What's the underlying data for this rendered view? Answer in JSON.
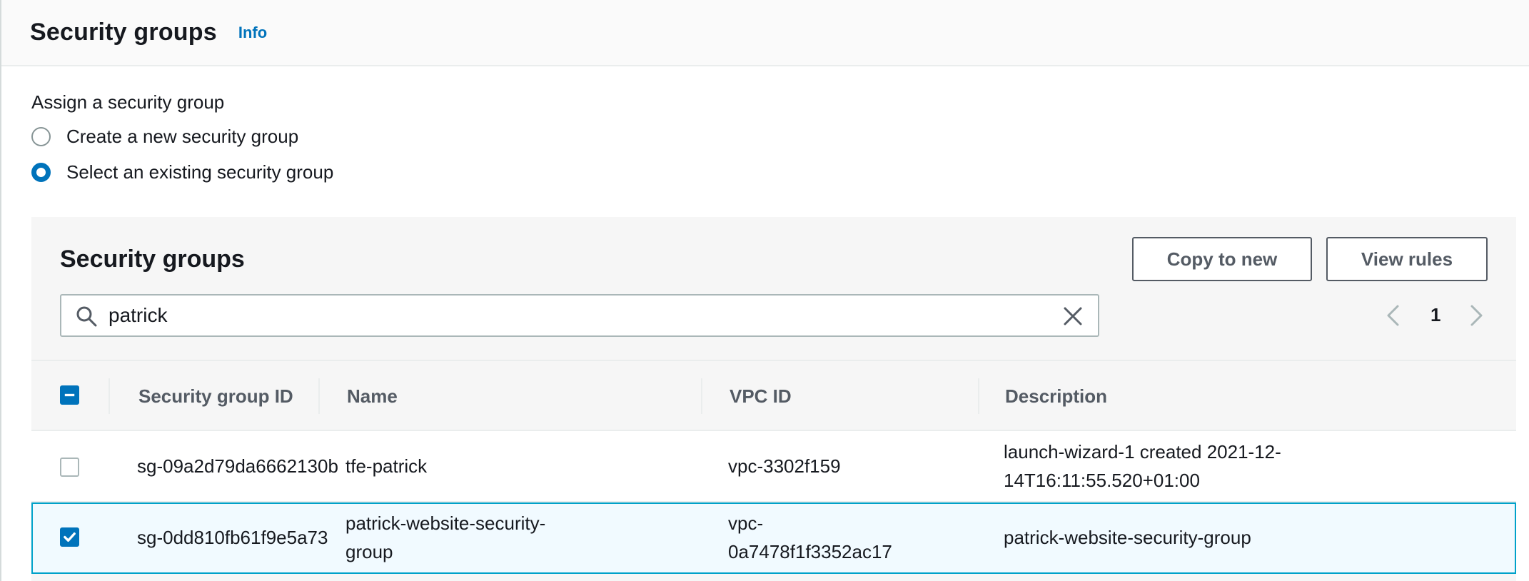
{
  "header": {
    "title": "Security groups",
    "info_label": "Info"
  },
  "assign": {
    "label": "Assign a security group",
    "options": [
      {
        "label": "Create a new security group",
        "selected": false
      },
      {
        "label": "Select an existing security group",
        "selected": true
      }
    ]
  },
  "table": {
    "title": "Security groups",
    "buttons": {
      "copy": "Copy to new",
      "view": "View rules"
    },
    "search": {
      "value": "patrick",
      "placeholder": ""
    },
    "pagination": {
      "page": "1"
    },
    "columns": [
      "Security group ID",
      "Name",
      "VPC ID",
      "Description"
    ],
    "rows": [
      {
        "selected": false,
        "id": "sg-09a2d79da6662130b",
        "name_line1": "tfe-patrick",
        "name_line2": "",
        "vpc_line1": "vpc-3302f159",
        "vpc_line2": "",
        "desc_line1": "launch-wizard-1 created 2021-12-",
        "desc_line2": "14T16:11:55.520+01:00"
      },
      {
        "selected": true,
        "id": "sg-0dd810fb61f9e5a73",
        "name_line1": "patrick-website-security-",
        "name_line2": "group",
        "vpc_line1": "vpc-",
        "vpc_line2": "0a7478f1f3352ac17",
        "desc_line1": "patrick-website-security-group",
        "desc_line2": ""
      }
    ]
  },
  "colors": {
    "accent": "#0073bb",
    "selected_row_bg": "#f1faff",
    "selected_row_border": "#00a1c9"
  }
}
